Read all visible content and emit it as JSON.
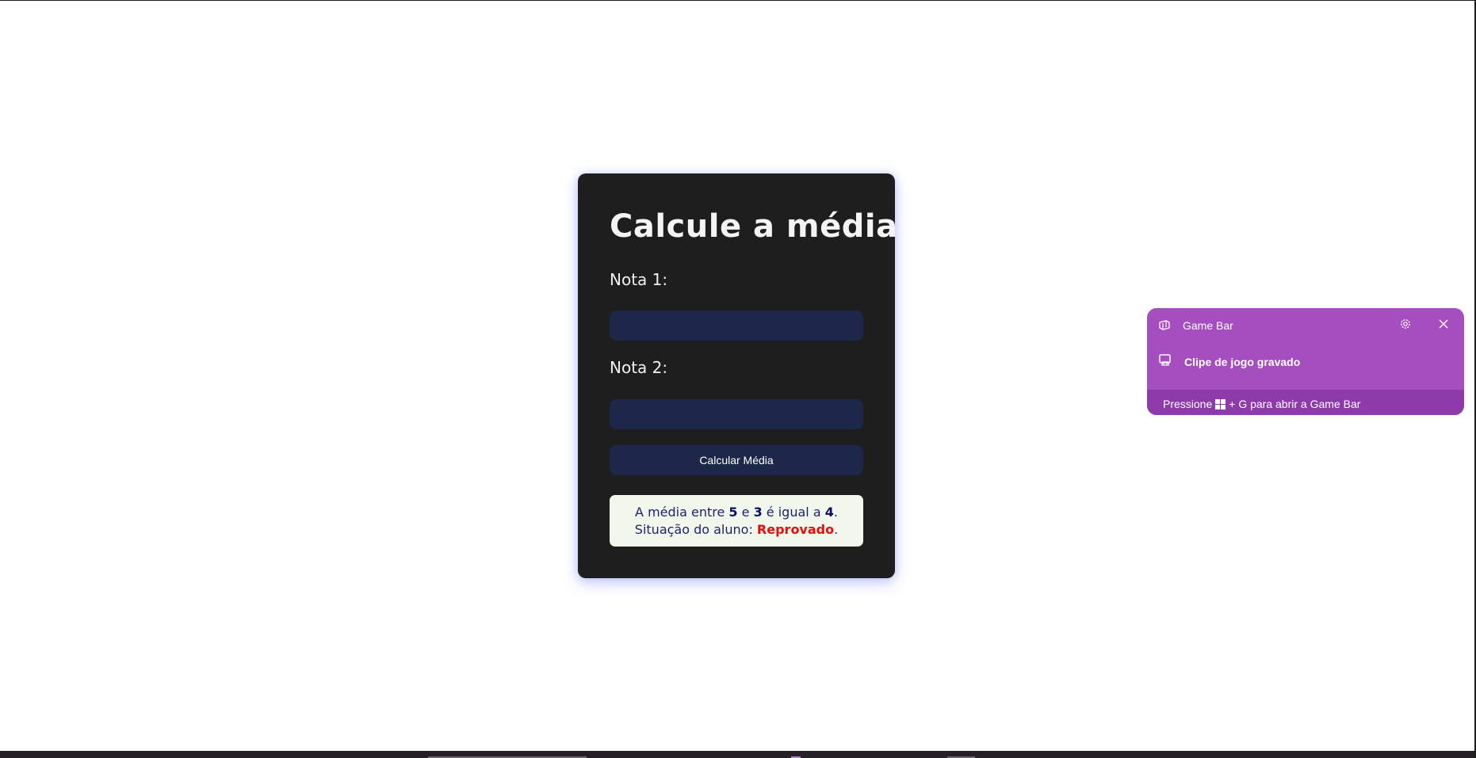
{
  "form": {
    "title": "Calcule a média",
    "nota1_label": "Nota 1:",
    "nota1_value": "",
    "nota2_label": "Nota 2:",
    "nota2_value": "",
    "button_label": "Calcular Média"
  },
  "result": {
    "prefix": "A média entre ",
    "value1": "5",
    "connector": " e ",
    "value2": "3",
    "middle": " é igual a ",
    "average": "4",
    "end": ".",
    "status_prefix": "Situação do aluno: ",
    "status": "Reprovado",
    "status_end": "."
  },
  "toast": {
    "app_name": "Game Bar",
    "message": "Clipe de jogo gravado",
    "hint_before": "Pressione",
    "hint_after": "+ G para abrir a Game Bar",
    "app_icon": "game-bar-icon",
    "settings_icon": "gear-icon",
    "close_icon": "close-icon",
    "message_icon": "game-clip-icon",
    "key_icon": "windows-key-icon"
  },
  "colors": {
    "page_background": "#ffffff",
    "card_background": "#1e1e1e",
    "input_background": "#1c274a",
    "result_background": "#f1f7ea",
    "fail_status": "#e01010",
    "toast_background": "#a54ebf",
    "toast_footer": "#8f3aab"
  }
}
